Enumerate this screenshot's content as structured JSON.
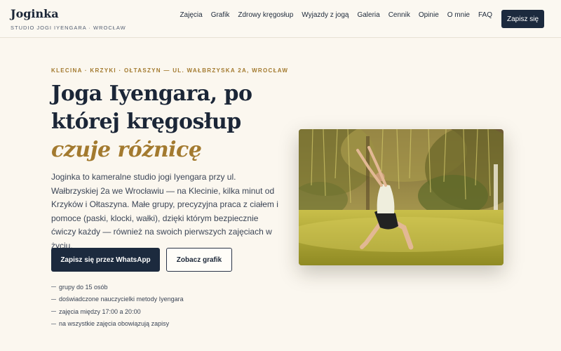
{
  "brand": {
    "name": "Joginka",
    "tagline": "STUDIO JOGI IYENGARA · WROCŁAW"
  },
  "nav": {
    "items": [
      "Zajęcia",
      "Grafik",
      "Zdrowy kręgosłup",
      "Wyjazdy z jogą",
      "Galeria",
      "Cennik",
      "Opinie",
      "O mnie",
      "FAQ"
    ],
    "cta_label": "Zapisz się"
  },
  "hero": {
    "eyebrow": "KLECINA · KRZYKI · OŁTASZYN — UL. WAŁBRZYSKA 2A, WROCŁAW",
    "headline_line1": "Joga Iyengara, po",
    "headline_line2": "której kręgosłup",
    "headline_accent": "czuje różnicę",
    "lead": "Joginka to kameralne studio jogi Iyengara przy ul. Wałbrzyskiej 2a we Wrocławiu — na Klecinie, kilka minut od Krzyków i Ołtaszyna. Małe grupy, precyzyjna praca z ciałem i pomoce (paski, klocki, wałki), dzięki którym bezpiecznie ćwiczy każdy — również na swoich pierwszych zajęciach w życiu.",
    "primary_button": "Zapisz się przez WhatsApp",
    "secondary_button": "Zobacz grafik",
    "features": [
      "grupy do 15 osób",
      "doświadczone nauczycielki metody Iyengara",
      "zajęcia między 17:00 a 20:00",
      "na wszystkie zajęcia obowiązują zapisy"
    ]
  },
  "colors": {
    "navy": "#1c2a3e",
    "accent_gold": "#a37a2f",
    "background": "#fbf7ef"
  }
}
